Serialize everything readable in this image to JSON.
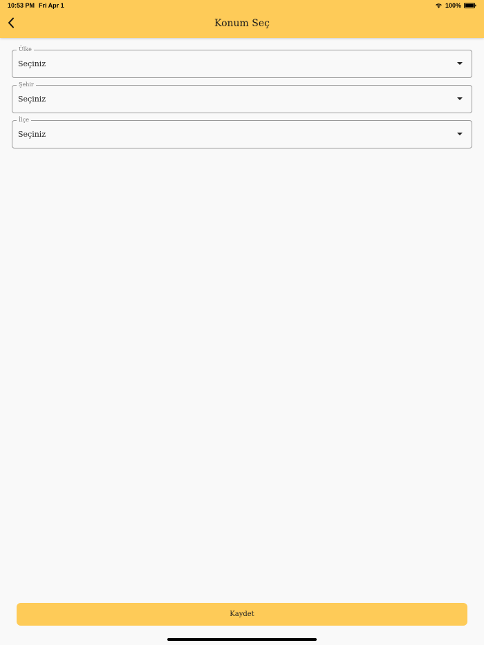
{
  "status_bar": {
    "time": "10:53 PM",
    "date": "Fri Apr 1",
    "battery": "100%",
    "icons": [
      "wifi-icon",
      "battery-icon"
    ]
  },
  "header": {
    "title": "Konum Seç",
    "back_icon": "chevron-left-icon",
    "background_color": "#fecb58"
  },
  "form": {
    "fields": [
      {
        "label": "Ülke",
        "value": "Seçiniz",
        "icon": "dropdown-arrow-icon"
      },
      {
        "label": "Şehir",
        "value": "Seçiniz",
        "icon": "dropdown-arrow-icon"
      },
      {
        "label": "İlçe",
        "value": "Seçiniz",
        "icon": "dropdown-arrow-icon"
      }
    ]
  },
  "footer": {
    "save_label": "Kaydet",
    "button_color": "#fecb58"
  }
}
